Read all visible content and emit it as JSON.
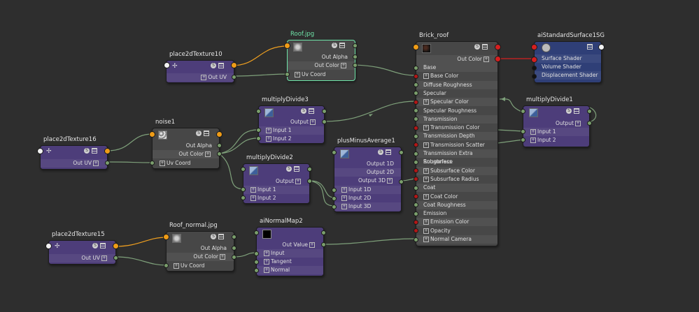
{
  "nodes": {
    "place2dTexture10": {
      "title": "place2dTexture10",
      "out_uv": "Out UV"
    },
    "roof_jpg": {
      "title": "Roof.jpg",
      "out_alpha": "Out Alpha",
      "out_color": "Out Color",
      "uv_coord": "Uv Coord"
    },
    "brick_roof": {
      "title": "Brick_roof",
      "out_color": "Out Color",
      "inputs": [
        "Base",
        "Base Color",
        "Diffuse Roughness",
        "Specular",
        "Specular Color",
        "Specular Roughness",
        "Transmission",
        "Transmission Color",
        "Transmission Depth",
        "Transmission Scatter",
        "Transmission Extra Roughness",
        "Subsurface",
        "Subsurface Color",
        "Subsurface Radius",
        "Coat",
        "Coat Color",
        "Coat Roughness",
        "Emission",
        "Emission Color",
        "Opacity",
        "Normal Camera"
      ]
    },
    "ai_sg": {
      "title": "aiStandardSurface1SG",
      "rows": [
        "Surface Shader",
        "Volume Shader",
        "Displacement Shader"
      ]
    },
    "multiplyDivide3": {
      "title": "multiplyDivide3",
      "output": "Output",
      "input1": "Input 1",
      "input2": "Input 2"
    },
    "multiplyDivide1": {
      "title": "multiplyDivide1",
      "output": "Output",
      "input1": "Input 1",
      "input2": "Input 2"
    },
    "noise1": {
      "title": "noise1",
      "out_alpha": "Out Alpha",
      "out_color": "Out Color",
      "uv_coord": "Uv Coord"
    },
    "place2dTexture16": {
      "title": "place2dTexture16",
      "out_uv": "Out UV"
    },
    "multiplyDivide2": {
      "title": "multiplyDivide2",
      "output": "Output",
      "input1": "Input 1",
      "input2": "Input 2"
    },
    "plusMinusAverage1": {
      "title": "plusMinusAverage1",
      "rows": [
        "Output 1D",
        "Output 2D",
        "Output 3D",
        "Input 1D",
        "Input 2D",
        "Input 3D"
      ]
    },
    "place2dTexture15": {
      "title": "place2dTexture15",
      "out_uv": "Out UV"
    },
    "roof_normal": {
      "title": "Roof_normal.jpg",
      "out_alpha": "Out Alpha",
      "out_color": "Out Color",
      "uv_coord": "Uv Coord"
    },
    "aiNormalMap2": {
      "title": "aiNormalMap2",
      "out_value": "Out Value",
      "rows": [
        "Input",
        "Tangent",
        "Normal"
      ]
    }
  },
  "colors": {
    "background": "#2e2e2e",
    "utility_node": "#4d3d7a",
    "texture_node": "#474747",
    "shading_group": "#2f3f77",
    "selection": "#6fe5a9",
    "wire_green": "#7ea07a",
    "wire_orange": "#f0a020",
    "wire_red": "#d42020"
  }
}
